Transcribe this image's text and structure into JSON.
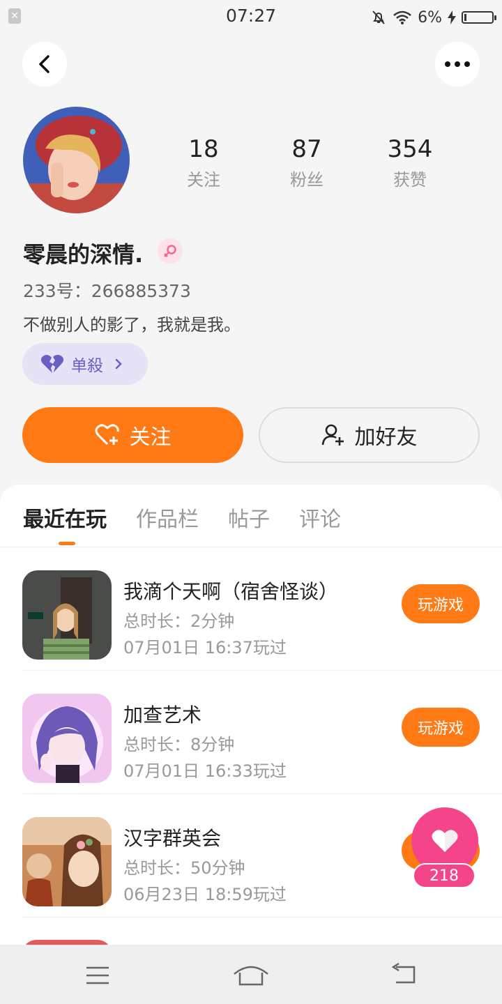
{
  "status_bar": {
    "time": "07:27",
    "battery": "6%"
  },
  "profile": {
    "name": "零晨的深情.",
    "uid": "233号：266885373",
    "bio": "不做别人的影了，我就是我。",
    "tag": "单殺",
    "stats": [
      {
        "value": "18",
        "label": "关注"
      },
      {
        "value": "87",
        "label": "粉丝"
      },
      {
        "value": "354",
        "label": "获赞"
      }
    ]
  },
  "actions": {
    "follow": "关注",
    "add_friend": "加好友"
  },
  "tabs": [
    {
      "label": "最近在玩"
    },
    {
      "label": "作品栏"
    },
    {
      "label": "帖子"
    },
    {
      "label": "评论"
    }
  ],
  "games": [
    {
      "title": "我滴个天啊（宿舍怪谈）",
      "duration": "总时长：2分钟",
      "last_played": "07月01日 16:37玩过",
      "play": "玩游戏"
    },
    {
      "title": "加查艺术",
      "duration": "总时长：8分钟",
      "last_played": "07月01日 16:33玩过",
      "play": "玩游戏"
    },
    {
      "title": "汉字群英会",
      "duration": "总时长：50分钟",
      "last_played": "06月23日 18:59玩过",
      "play": "玩游戏"
    }
  ],
  "like": {
    "count": "218"
  },
  "colors": {
    "accent": "#ff7a14",
    "like": "#f5458a",
    "tag_bg": "#e7e3f7"
  }
}
